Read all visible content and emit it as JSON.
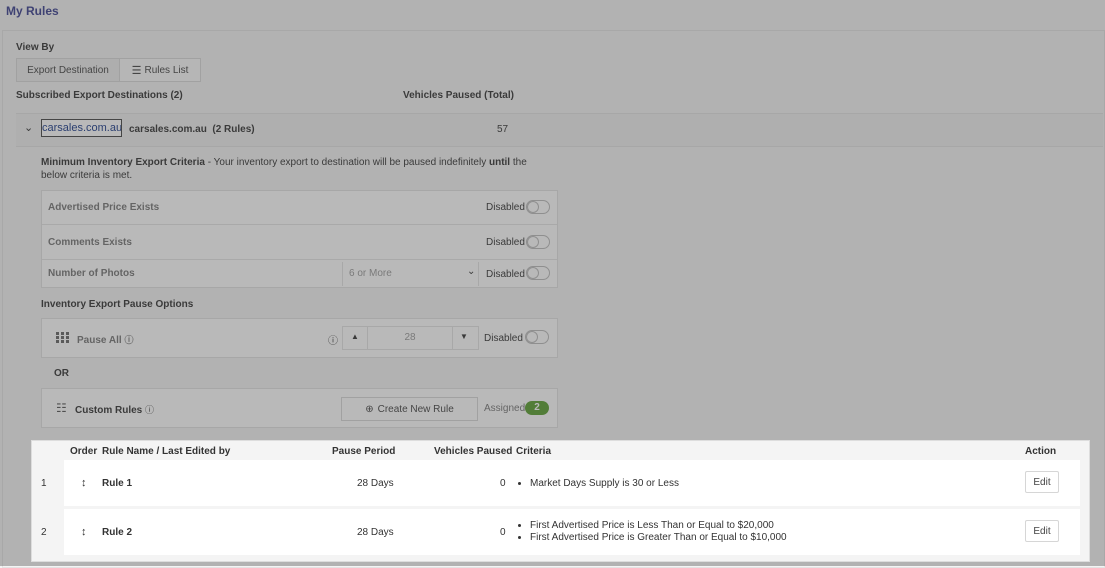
{
  "page": {
    "title": "My Rules"
  },
  "view_by": {
    "label": "View By",
    "tabs": [
      "Export Destination",
      "Rules List"
    ]
  },
  "header": {
    "destinations_label": "Subscribed Export Destinations (2)",
    "vehicles_paused_label": "Vehicles Paused (Total)"
  },
  "destination": {
    "logo_text": "carsales.com.au",
    "name": "carsales.com.au",
    "rules_count": "(2 Rules)",
    "vehicles_paused": "57"
  },
  "criteria": {
    "heading_bold": "Minimum Inventory Export Criteria",
    "heading_text_1": " - Your inventory export to destination will be paused indefinitely ",
    "heading_until": "until",
    "heading_text_2": " the below criteria is met.",
    "rows": [
      {
        "label": "Advertised Price Exists",
        "status": "Disabled"
      },
      {
        "label": "Comments Exists",
        "status": "Disabled"
      },
      {
        "label": "Number of Photos",
        "select_value": "6 or More",
        "status": "Disabled"
      }
    ]
  },
  "pause": {
    "heading": "Inventory Export Pause Options",
    "pause_all_label": "Pause All",
    "pause_all_value": "28",
    "pause_all_status": "Disabled",
    "or_label": "OR",
    "custom_rules_label": "Custom Rules",
    "create_button": "Create New Rule",
    "assigned_label": "Assigned",
    "assigned_count": "2"
  },
  "rules_table": {
    "columns": {
      "order": "Order",
      "name": "Rule Name / Last Edited by",
      "pause": "Pause Period",
      "vehicles": "Vehicles Paused",
      "criteria": "Criteria",
      "action": "Action"
    },
    "rows": [
      {
        "index": "1",
        "name": "Rule 1",
        "pause": "28 Days",
        "vehicles": "0",
        "criteria": [
          "Market Days Supply is 30 or Less"
        ],
        "action": "Edit"
      },
      {
        "index": "2",
        "name": "Rule 2",
        "pause": "28 Days",
        "vehicles": "0",
        "criteria": [
          "First Advertised Price is Less Than or Equal to $20,000",
          "First Advertised Price is Greater Than or Equal to $10,000"
        ],
        "action": "Edit"
      }
    ]
  },
  "colors": {
    "accent": "#3a3f8f",
    "badge_green": "#5a9e2f"
  }
}
